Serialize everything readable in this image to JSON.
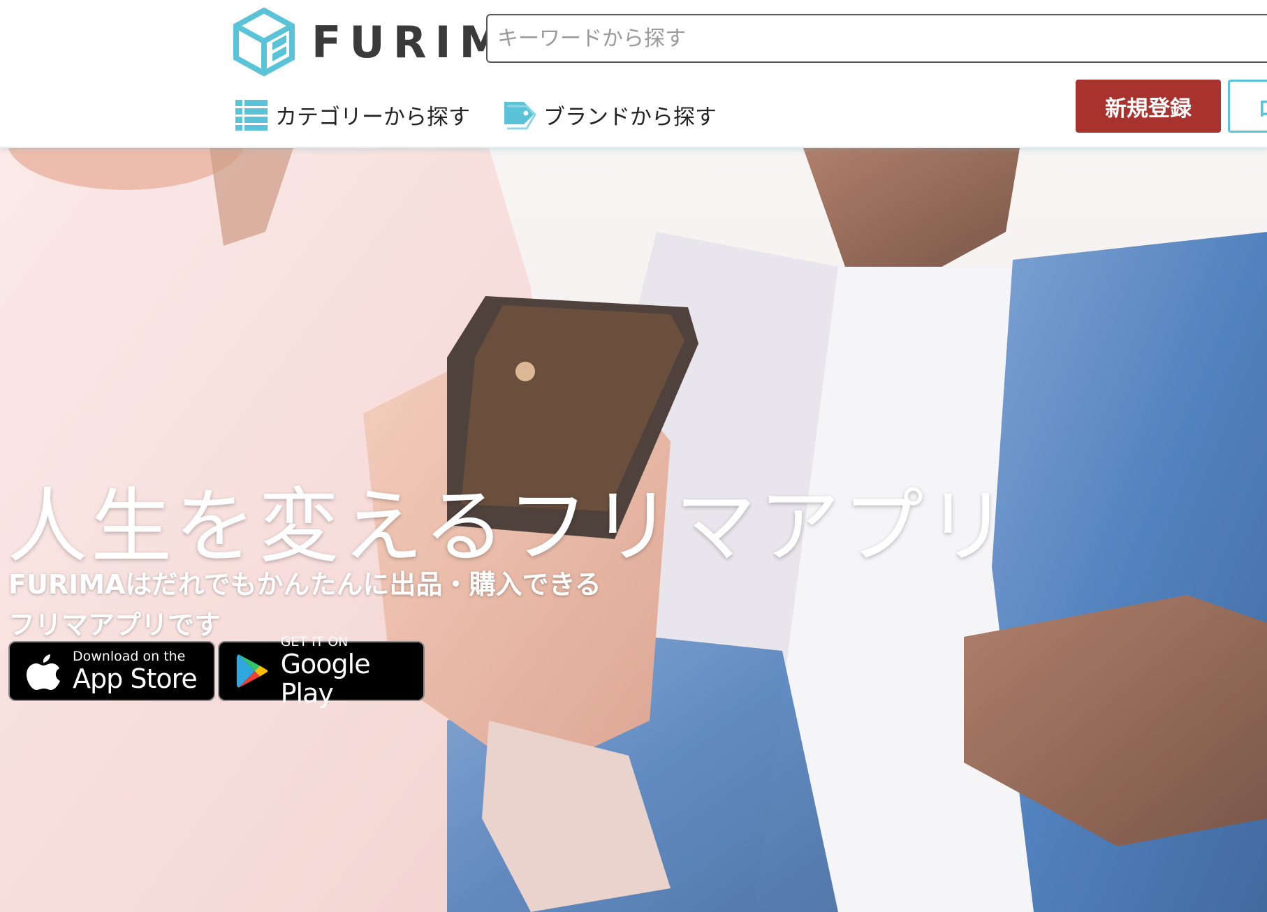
{
  "header": {
    "logo_text": "FURIMA",
    "search_placeholder": "キーワードから探す",
    "nav": {
      "categories": "カテゴリーから探す",
      "brands": "ブランドから探す"
    },
    "signup_label": "新規登録",
    "login_label": "ロ"
  },
  "hero": {
    "title": "人生を変えるフリマアプリ",
    "subtitle_line1": "FURIMAはだれでもかんたんに出品・購入できる",
    "subtitle_line2": "フリマアプリです",
    "app_store": {
      "small": "Download on the",
      "big": "App Store"
    },
    "google_play": {
      "small": "GET IT ON",
      "big": "Google Play"
    }
  },
  "colors": {
    "accent": "#5bc3d8",
    "signup": "#a8322d",
    "logo": "#5bc3d8"
  }
}
